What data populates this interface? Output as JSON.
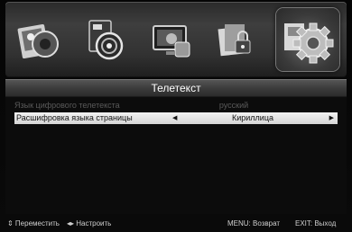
{
  "menu": {
    "icons": [
      {
        "name": "picture-icon"
      },
      {
        "name": "sound-icon"
      },
      {
        "name": "tv-channel-icon"
      },
      {
        "name": "lock-icon"
      },
      {
        "name": "settings-gear-icon",
        "selected": true
      }
    ]
  },
  "title": "Телетекст",
  "rows": [
    {
      "label": "Язык цифрового телетекста",
      "value": "русский",
      "state": "disabled"
    },
    {
      "label": "Расшифровка языка страницы",
      "value": "Кириллица",
      "state": "selected"
    }
  ],
  "footer": {
    "move": "⇕ Переместить",
    "adjust": "◂▸ Настроить",
    "menu": "MENU: Возврат",
    "exit": "EXIT: Выход"
  }
}
